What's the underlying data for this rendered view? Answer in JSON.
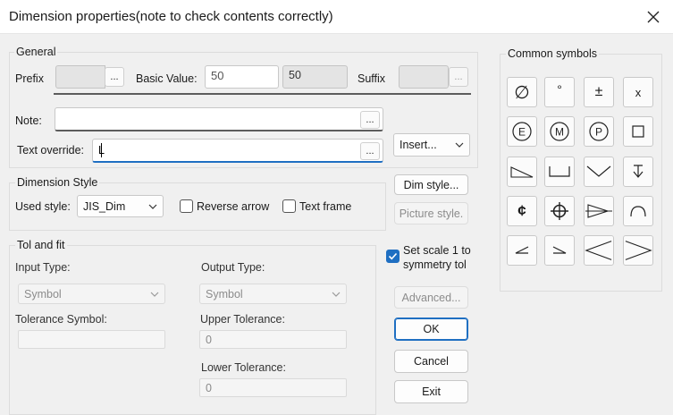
{
  "window": {
    "title": "Dimension properties(note to check contents correctly)"
  },
  "general": {
    "title": "General",
    "prefix_label": "Prefix",
    "prefix_value": "",
    "basic_value_label": "Basic Value:",
    "basic_value": "50",
    "basic_value_display": "50",
    "suffix_label": "Suffix",
    "suffix_value": "",
    "note_label": "Note:",
    "note_value": "",
    "text_override_label": "Text override:",
    "text_override_value": "L",
    "insert_label": "Insert...",
    "ellipsis": "..."
  },
  "dimension_style": {
    "title": "Dimension Style",
    "used_style_label": "Used style:",
    "used_style_value": "JIS_Dim",
    "reverse_arrow_label": "Reverse arrow",
    "reverse_arrow_checked": false,
    "text_frame_label": "Text frame",
    "text_frame_checked": false
  },
  "tol_fit": {
    "title": "Tol and fit",
    "input_type_label": "Input Type:",
    "input_type_value": "Symbol",
    "output_type_label": "Output Type:",
    "output_type_value": "Symbol",
    "tolerance_symbol_label": "Tolerance Symbol:",
    "tolerance_symbol_value": "",
    "upper_tolerance_label": "Upper Tolerance:",
    "upper_tolerance_value": "0",
    "lower_tolerance_label": "Lower Tolerance:",
    "lower_tolerance_value": "0"
  },
  "buttons": {
    "dim_style": "Dim style...",
    "picture_style": "Picture style.",
    "set_scale_label": "Set scale 1 to symmetry tol",
    "set_scale_checked": true,
    "advanced": "Advanced...",
    "ok": "OK",
    "cancel": "Cancel",
    "exit": "Exit"
  },
  "common_symbols": {
    "title": "Common symbols",
    "symbols": [
      {
        "icon": "diameter-icon",
        "glyph": "∅"
      },
      {
        "icon": "degree-icon",
        "glyph": "°"
      },
      {
        "icon": "plus-minus-icon",
        "glyph": "±"
      },
      {
        "icon": "multiply-icon",
        "glyph": "x"
      },
      {
        "icon": "circled-e-icon",
        "glyph": "E"
      },
      {
        "icon": "circled-m-icon",
        "glyph": "M"
      },
      {
        "icon": "circled-p-icon",
        "glyph": "P"
      },
      {
        "icon": "square-icon",
        "glyph": ""
      },
      {
        "icon": "slope-icon",
        "glyph": ""
      },
      {
        "icon": "counterbore-icon",
        "glyph": ""
      },
      {
        "icon": "countersink-icon",
        "glyph": ""
      },
      {
        "icon": "depth-icon",
        "glyph": ""
      },
      {
        "icon": "centerline-icon",
        "glyph": "¢"
      },
      {
        "icon": "center-mark-icon",
        "glyph": ""
      },
      {
        "icon": "conical-taper-icon",
        "glyph": ""
      },
      {
        "icon": "arc-length-icon",
        "glyph": ""
      },
      {
        "icon": "small-angle-left-icon",
        "glyph": ""
      },
      {
        "icon": "small-angle-right-icon",
        "glyph": ""
      },
      {
        "icon": "less-than-icon",
        "glyph": ""
      },
      {
        "icon": "greater-than-icon",
        "glyph": ""
      }
    ]
  }
}
